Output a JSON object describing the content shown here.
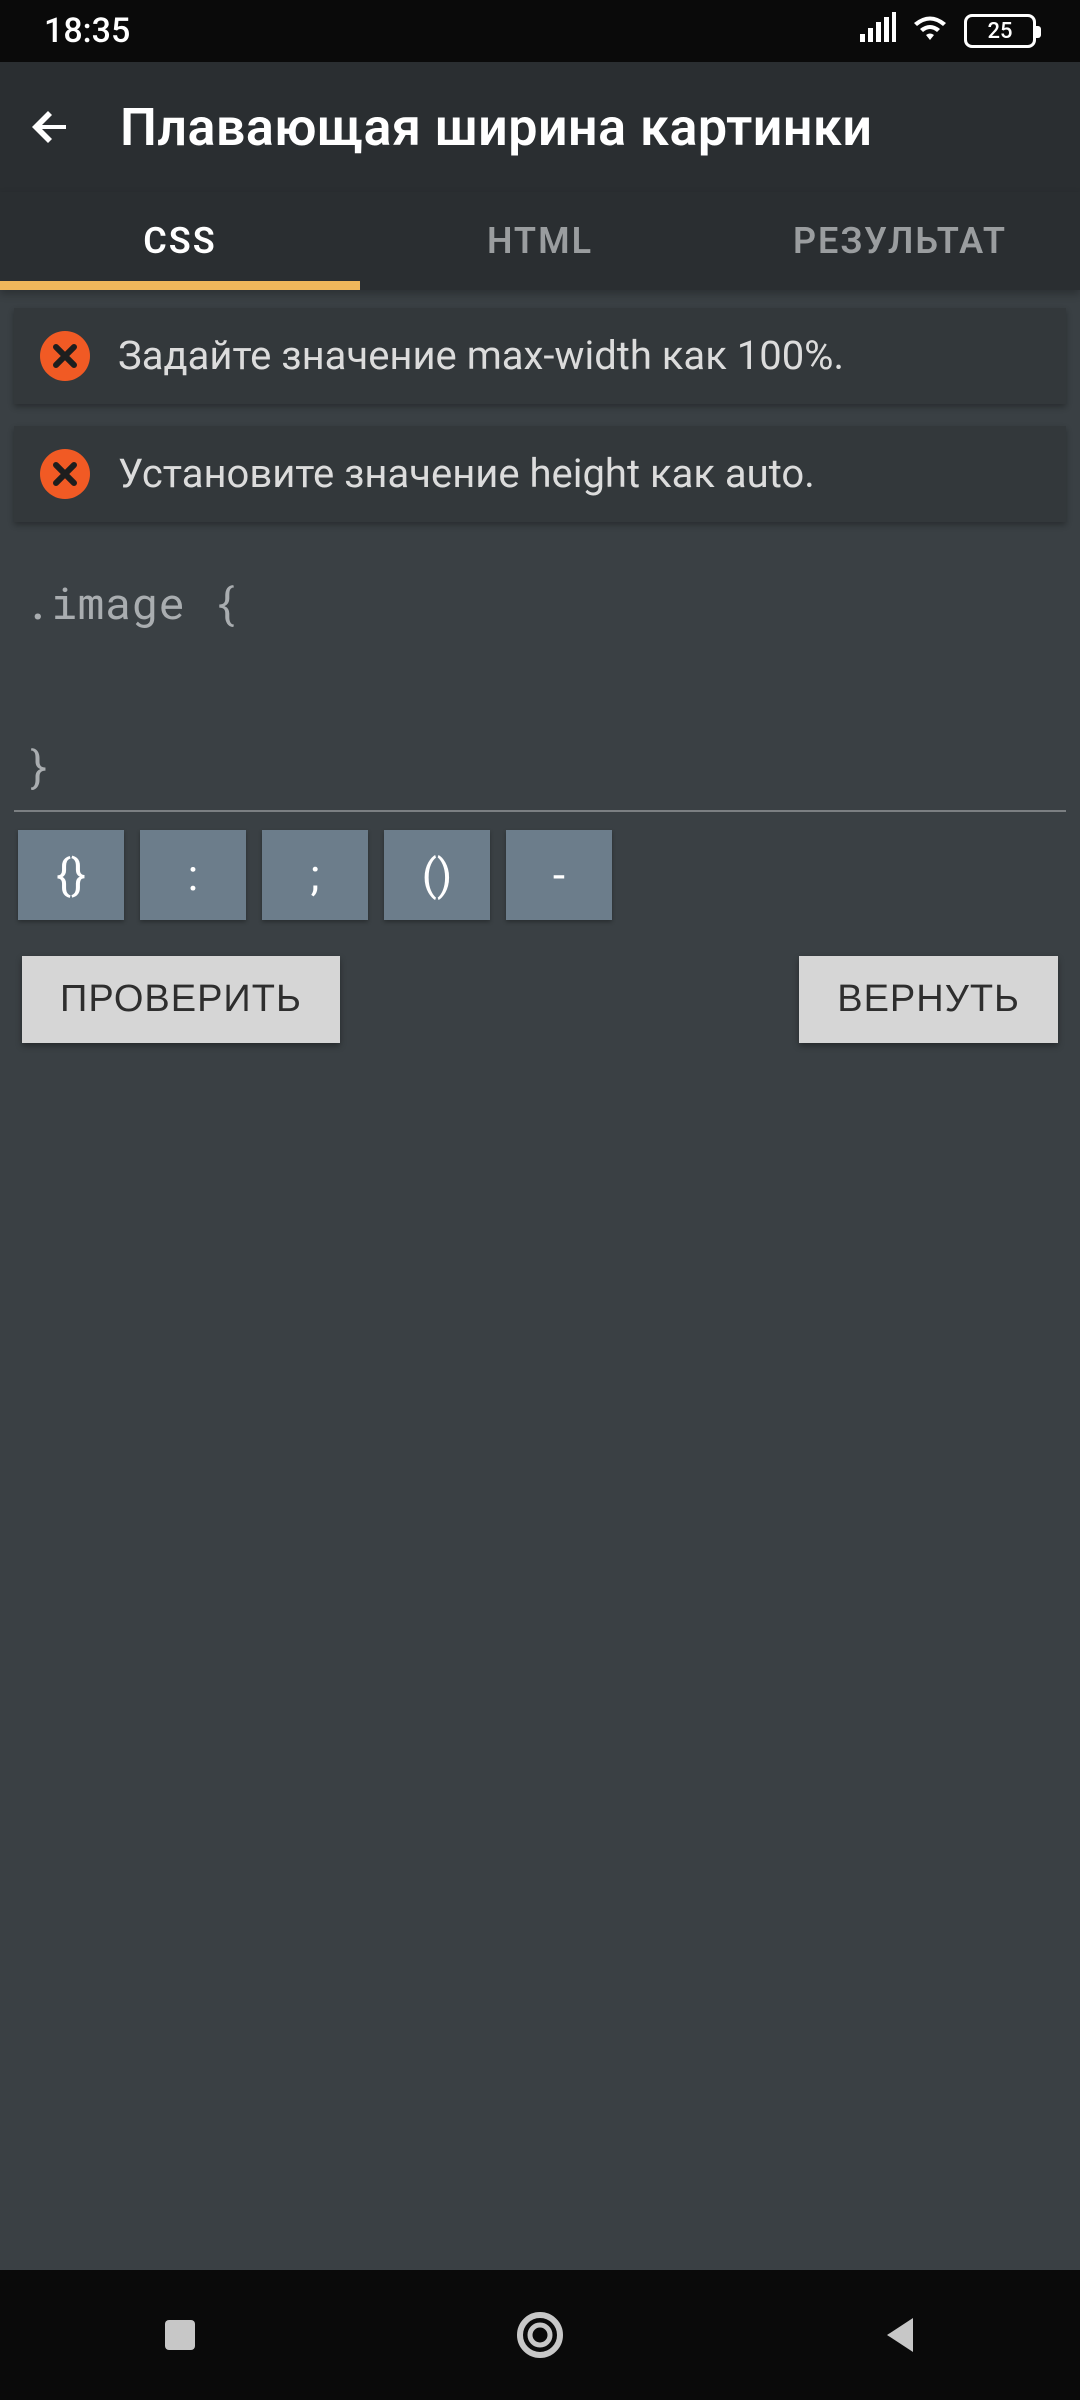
{
  "status": {
    "time": "18:35",
    "battery": "25"
  },
  "appbar": {
    "title": "Плавающая ширина картинки"
  },
  "tabs": {
    "css": "CSS",
    "html": "HTML",
    "result": "РЕЗУЛЬТАТ"
  },
  "hints": [
    "Задайте значение max-width как 100%.",
    "Установите значение height как auto."
  ],
  "code": ".image {\n\n}",
  "symbols": [
    "{}",
    ":",
    ";",
    "()",
    "-"
  ],
  "actions": {
    "check": "ПРОВЕРИТЬ",
    "revert": "ВЕРНУТЬ"
  }
}
